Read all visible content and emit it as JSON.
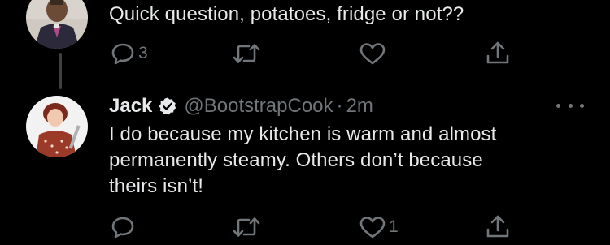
{
  "tweets": [
    {
      "text": "Quick question, potatoes, fridge or not??",
      "reply_count": "3",
      "retweet_count": "",
      "like_count": ""
    },
    {
      "name": "Jack",
      "handle": "@BootstrapCook",
      "separator": "·",
      "time": "2m",
      "text": "I do because my kitchen is warm and almost\npermanently steamy. Others don’t because\ntheirs isn’t!",
      "reply_count": "",
      "retweet_count": "",
      "like_count": "1"
    }
  ],
  "colors": {
    "background": "#000000",
    "text": "#e7e9ea",
    "secondary": "#71767b",
    "thread_line": "#3e4144"
  },
  "icons": {
    "reply": "reply-icon",
    "retweet": "retweet-icon",
    "like": "like-icon",
    "share": "share-icon",
    "verified": "verified-badge-icon",
    "more": "more-options-icon"
  }
}
